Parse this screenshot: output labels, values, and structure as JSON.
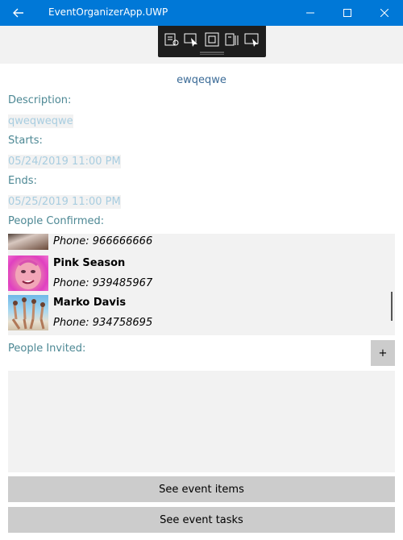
{
  "window": {
    "title": "EventOrganizerApp.UWP"
  },
  "event": {
    "name": "ewqeqwe",
    "description_label": "Description:",
    "description": "qweqweqwe",
    "starts_label": "Starts:",
    "starts": "05/24/2019 11:00 PM",
    "ends_label": "Ends:",
    "ends": "05/25/2019 11:00 PM",
    "confirmed_label": "People Confirmed:",
    "invited_label": "People Invited:"
  },
  "confirmed": [
    {
      "name": "",
      "phone": "Phone: 966666666"
    },
    {
      "name": "Pink Season",
      "phone": "Phone: 939485967"
    },
    {
      "name": "Marko Davis",
      "phone": "Phone: 934758695"
    }
  ],
  "buttons": {
    "add": "+",
    "items": "See event items",
    "tasks": "See event tasks"
  },
  "colors": {
    "titlebar": "#0078d7",
    "label": "#4d8894",
    "value": "#a8cde0",
    "button": "#cccccc"
  }
}
